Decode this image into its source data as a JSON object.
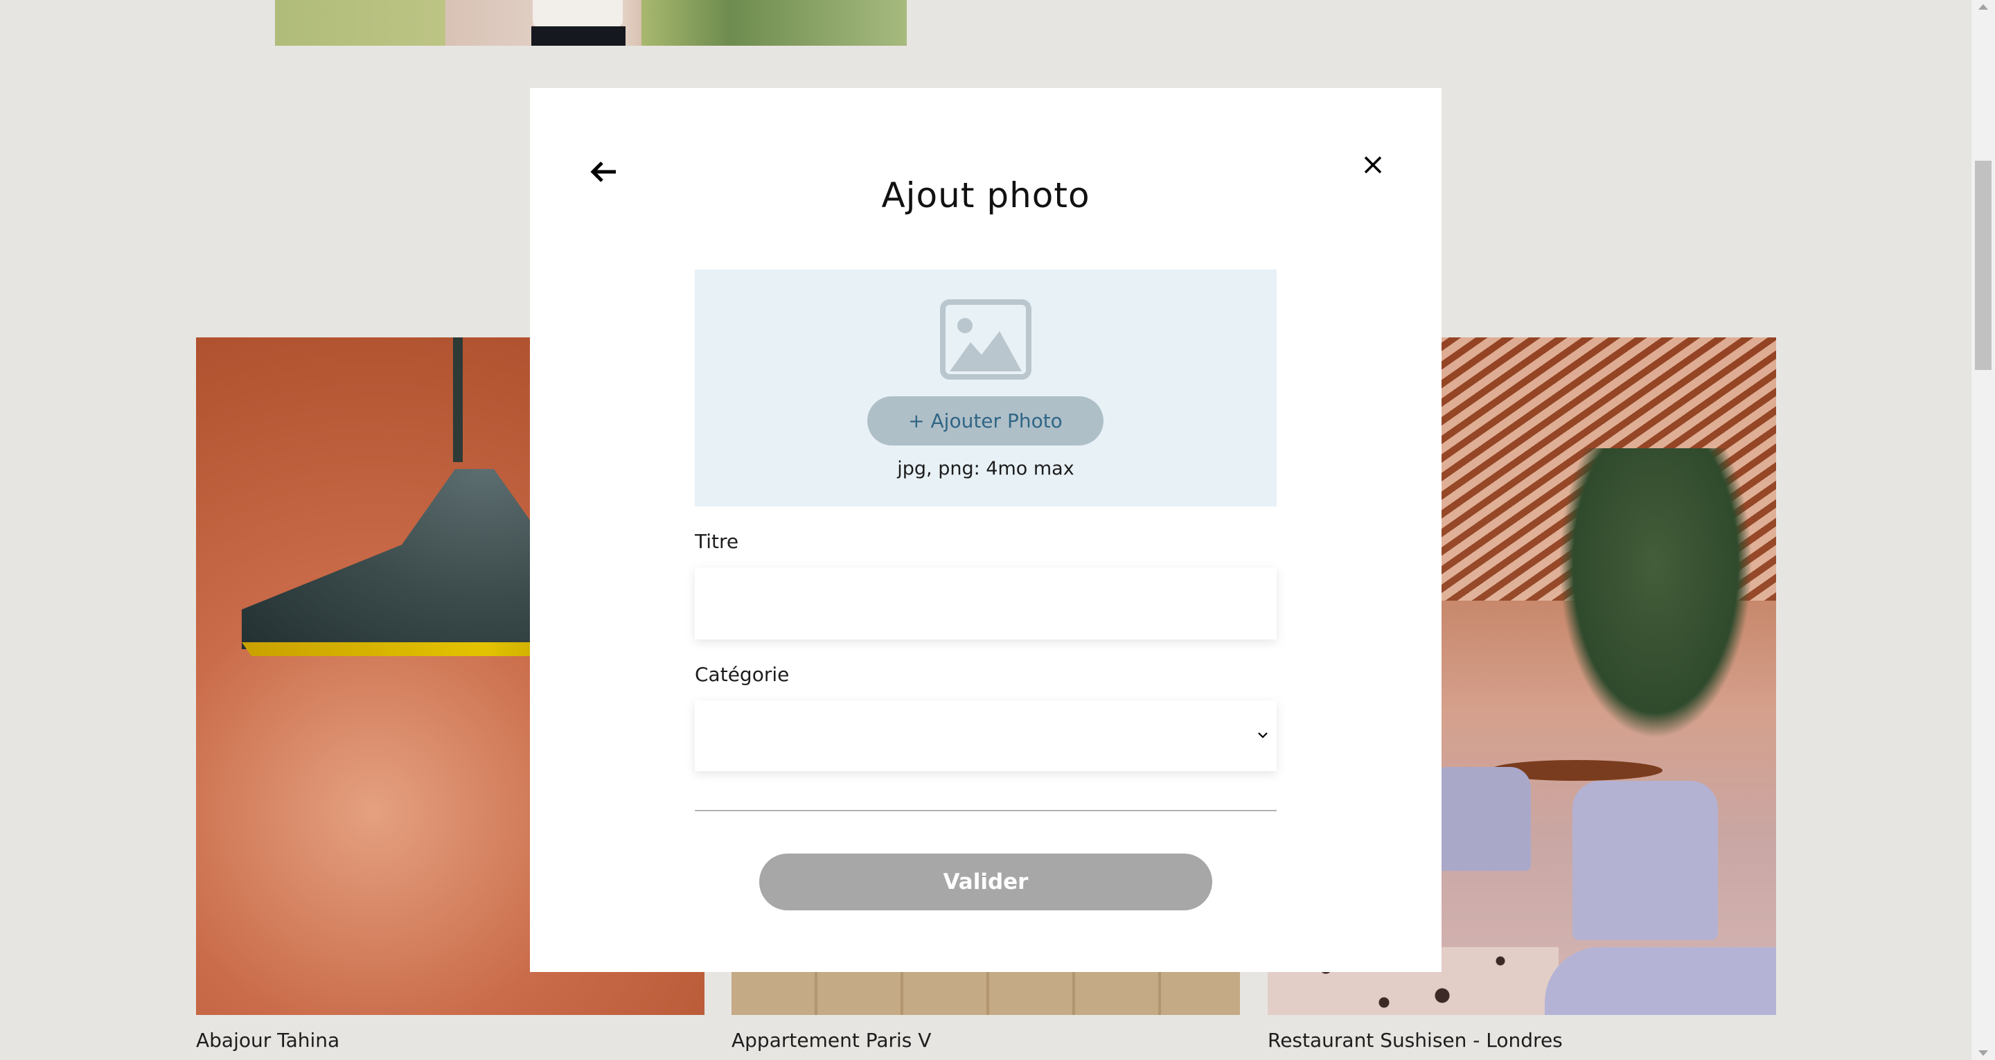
{
  "modal": {
    "title": "Ajout photo",
    "back_icon": "arrow-left-icon",
    "close_icon": "close-icon",
    "upload": {
      "icon": "image-placeholder-icon",
      "button_label": "+ Ajouter Photo",
      "hint": "jpg, png: 4mo max"
    },
    "title_field": {
      "label": "Titre",
      "value": ""
    },
    "category_field": {
      "label": "Catégorie",
      "value": "",
      "icon": "chevron-down-icon"
    },
    "submit_label": "Valider"
  },
  "gallery": {
    "items": [
      {
        "caption": "Abajour Tahina"
      },
      {
        "caption": "Appartement Paris V"
      },
      {
        "caption": "Restaurant Sushisen - Londres"
      }
    ]
  },
  "colors": {
    "page_background": "#E7E5E1",
    "upload_zone": "#E8F1F6",
    "add_photo_button": "#AFBFC8",
    "add_photo_text": "#306685",
    "submit_button": "#A7A7A7"
  }
}
